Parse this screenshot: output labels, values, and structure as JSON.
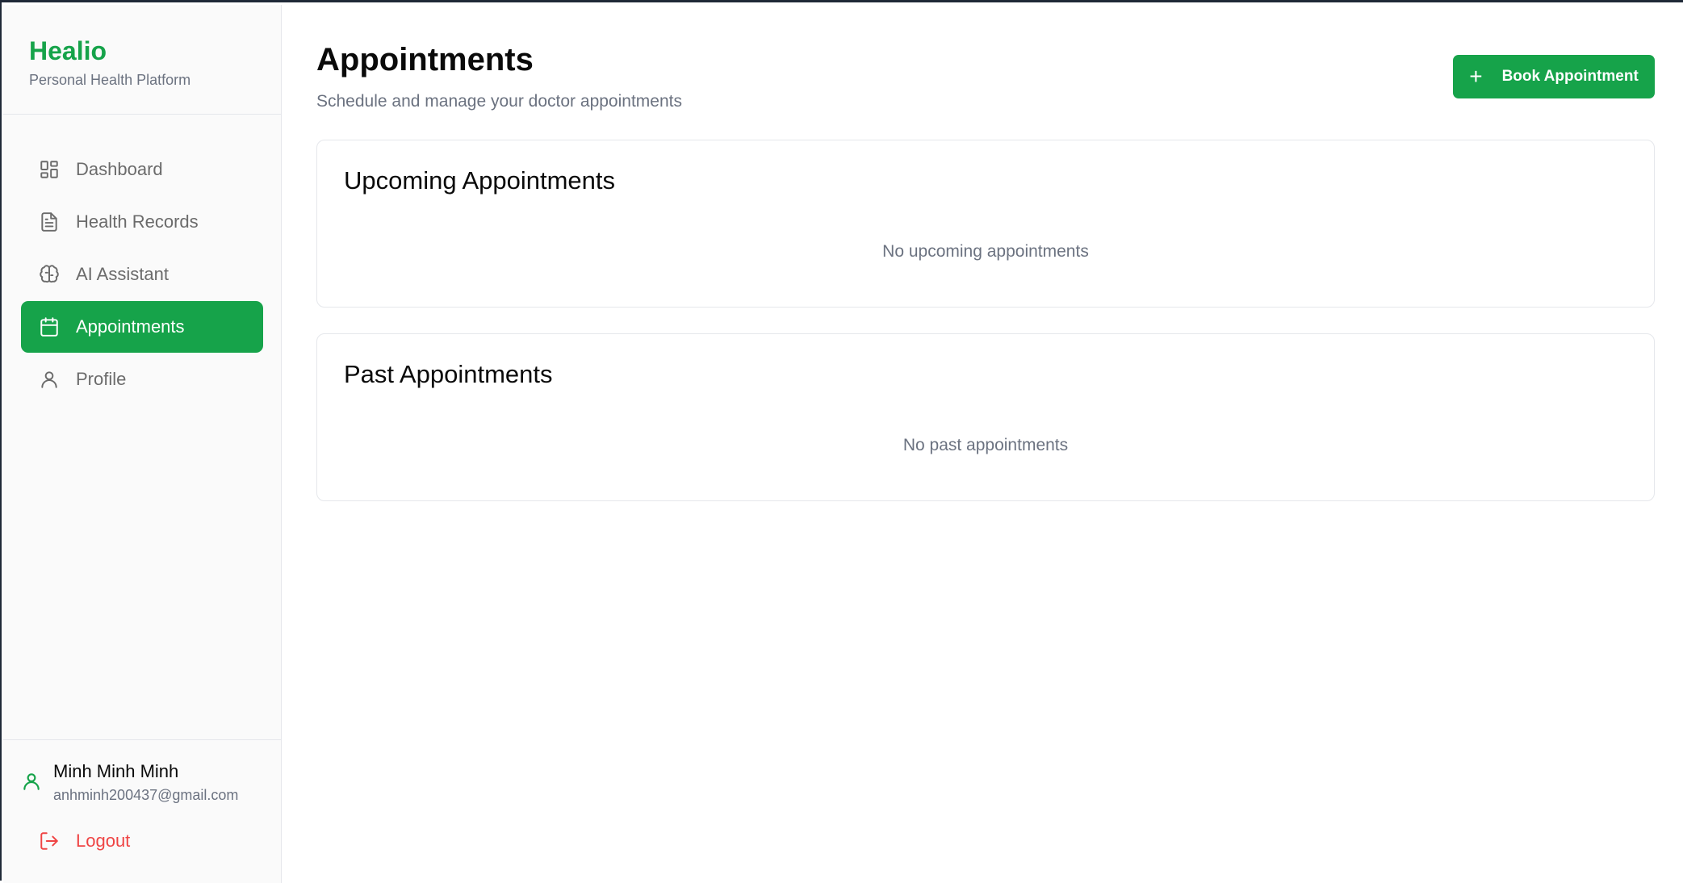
{
  "brand": {
    "name": "Healio",
    "tagline": "Personal Health Platform"
  },
  "nav": [
    {
      "label": "Dashboard",
      "icon": "dashboard-icon",
      "active": false
    },
    {
      "label": "Health Records",
      "icon": "file-text-icon",
      "active": false
    },
    {
      "label": "AI Assistant",
      "icon": "brain-icon",
      "active": false
    },
    {
      "label": "Appointments",
      "icon": "calendar-icon",
      "active": true
    },
    {
      "label": "Profile",
      "icon": "user-icon",
      "active": false
    }
  ],
  "user": {
    "name": "Minh Minh Minh",
    "email": "anhminh200437@gmail.com"
  },
  "logout_label": "Logout",
  "page": {
    "title": "Appointments",
    "subtitle": "Schedule and manage your doctor appointments",
    "book_button": "Book Appointment"
  },
  "sections": {
    "upcoming": {
      "title": "Upcoming Appointments",
      "empty": "No upcoming appointments"
    },
    "past": {
      "title": "Past Appointments",
      "empty": "No past appointments"
    }
  },
  "colors": {
    "accent": "#16a34a",
    "danger": "#ef4444",
    "muted": "#6b7280"
  }
}
